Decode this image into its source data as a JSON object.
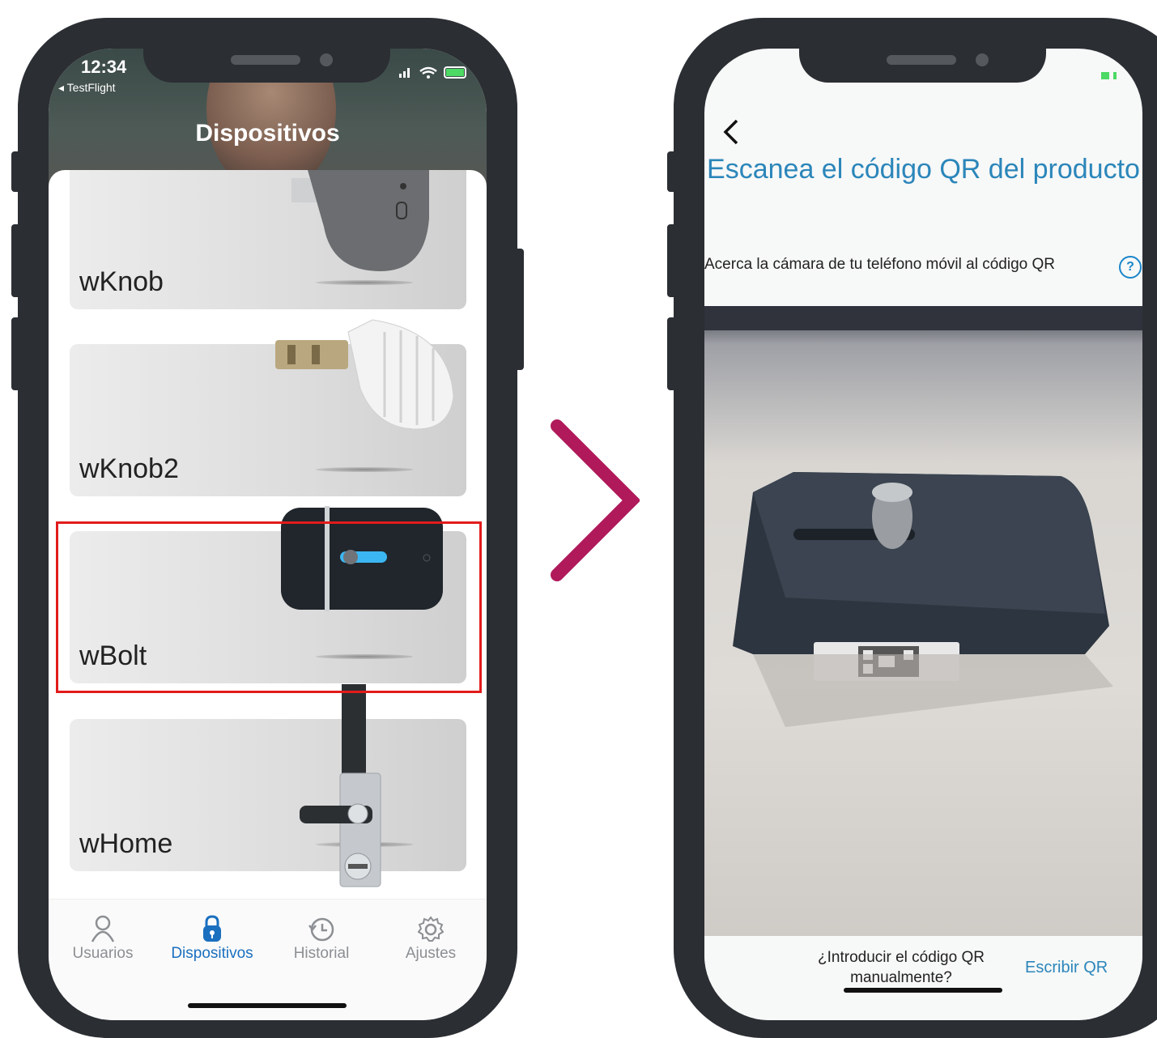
{
  "left_screen": {
    "status": {
      "time": "12:34",
      "back_app": "◂ TestFlight"
    },
    "title": "Dispositivos",
    "devices": [
      {
        "name": "wKnob"
      },
      {
        "name": "wKnob2"
      },
      {
        "name": "wBolt",
        "highlighted": true
      },
      {
        "name": "wHome"
      }
    ],
    "tabs": [
      {
        "label": "Usuarios",
        "icon": "user-icon",
        "active": false
      },
      {
        "label": "Dispositivos",
        "icon": "lock-icon",
        "active": true
      },
      {
        "label": "Historial",
        "icon": "history-icon",
        "active": false
      },
      {
        "label": "Ajustes",
        "icon": "gear-icon",
        "active": false
      }
    ]
  },
  "right_screen": {
    "title": "Escanea el código QR del producto",
    "subtitle": "Acerca la cámara de tu teléfono móvil al código QR",
    "help_icon": "?",
    "manual_question": "¿Introducir el código QR manualmente?",
    "manual_link": "Escribir QR"
  },
  "colors": {
    "accent_blue": "#1a6fbf",
    "title_blue": "#2b86ba",
    "highlight_red": "#e21b1b",
    "arrow_magenta": "#b0195a",
    "frame": "#2b2e33"
  }
}
